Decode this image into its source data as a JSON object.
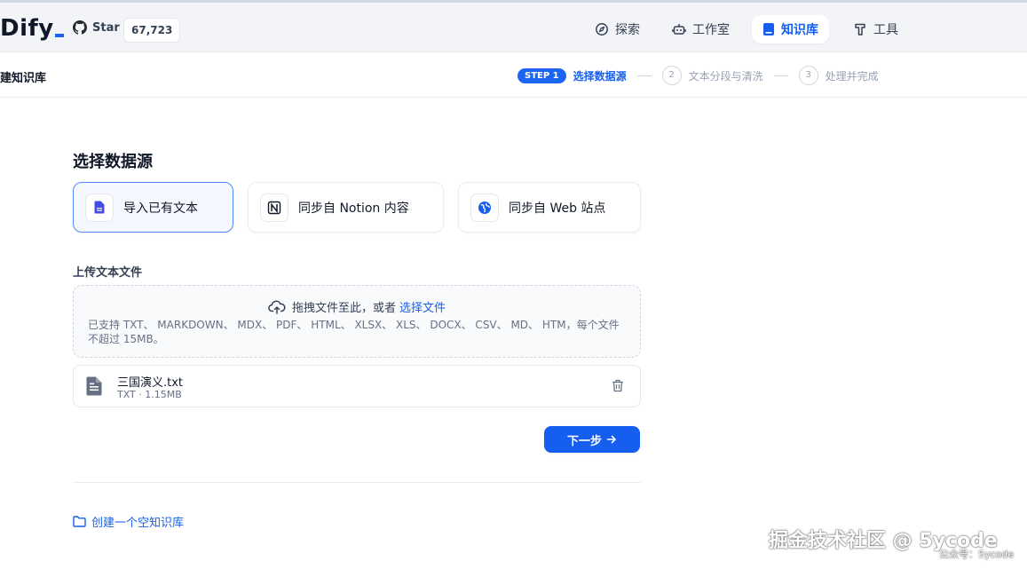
{
  "header": {
    "logo": "Dify",
    "star_label": "Star",
    "star_count": "67,723",
    "nav": [
      {
        "label": "探索"
      },
      {
        "label": "工作室"
      },
      {
        "label": "知识库",
        "active": true
      },
      {
        "label": "工具"
      }
    ]
  },
  "subheader": {
    "title": "创建知识库",
    "steps": [
      {
        "badge": "STEP 1",
        "label": "选择数据源",
        "active": true
      },
      {
        "number": "2",
        "label": "文本分段与清洗"
      },
      {
        "number": "3",
        "label": "处理并完成"
      }
    ]
  },
  "main": {
    "section_title": "选择数据源",
    "sources": [
      {
        "label": "导入已有文本",
        "icon": "file-text-icon",
        "active": true
      },
      {
        "label": "同步自 Notion 内容",
        "icon": "notion-icon"
      },
      {
        "label": "同步自 Web 站点",
        "icon": "globe-icon"
      }
    ],
    "upload_title": "上传文本文件",
    "dropzone": {
      "prompt": "拖拽文件至此，或者",
      "link": "选择文件",
      "supported": "已支持 TXT、 MARKDOWN、 MDX、 PDF、 HTML、 XLSX、 XLS、 DOCX、 CSV、 MD、 HTM，每个文件不超过 15MB。"
    },
    "file": {
      "name": "三国演义.txt",
      "meta": "TXT · 1.15MB"
    },
    "next_button": "下一步",
    "empty_link": "创建一个空知识库"
  },
  "watermark": {
    "main": "掘金技术社区 @ 5ycode",
    "sub": "公众号：5ycode"
  },
  "colors": {
    "accent": "#155eef",
    "active_card_bg": "#f5f8ff",
    "header_bg": "#f2f4f7"
  }
}
